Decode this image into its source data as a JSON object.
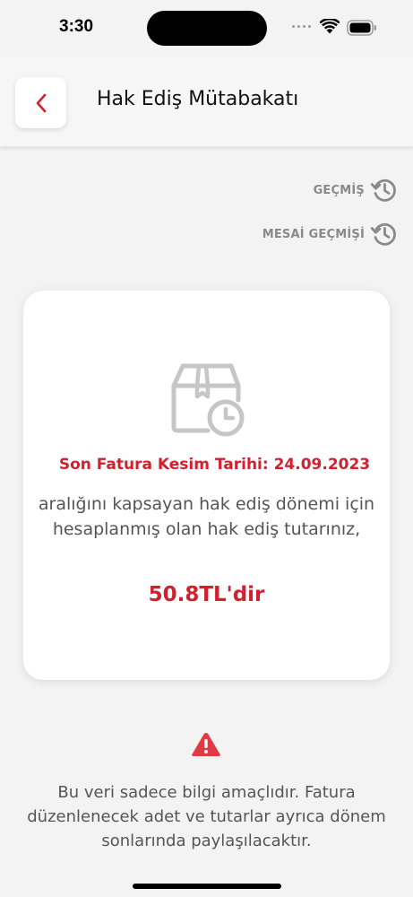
{
  "status_bar": {
    "time": "3:30"
  },
  "header": {
    "title": "Hak Ediş Mütabakatı",
    "back_icon": "chevron-left-icon"
  },
  "links": {
    "history_label": "GEÇMİŞ",
    "overtime_history_label": "MESAİ GEÇMİŞİ",
    "icon": "history-icon"
  },
  "card": {
    "icon": "box-clock-icon",
    "invoice_date_text": "Son Fatura Kesim Tarihi: 24.09.2023",
    "description": "aralığını kapsayan hak ediş dönemi için hesaplanmış olan hak ediş tutarınız,",
    "amount": "50.8TL'dir"
  },
  "notice": {
    "icon": "warning-icon",
    "text": "Bu veri sadece bilgi amaçlıdır. Fatura düzenlenecek adet ve tutarlar ayrıca dönem sonlarında paylaşılacaktır."
  },
  "colors": {
    "accent": "#d3202f",
    "muted": "#8a8a8a",
    "background": "#f3f3f3"
  }
}
